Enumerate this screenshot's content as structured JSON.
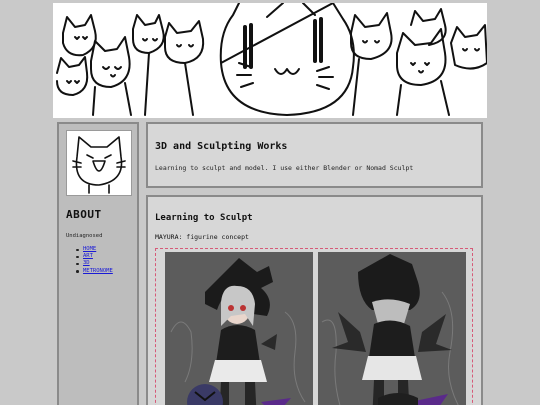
{
  "header": {
    "title": "3D and Sculpting Works",
    "subtitle": "Learning to sculpt and model. I use either Blender or Nomad Sculpt"
  },
  "sidebar": {
    "heading": "ABOUT",
    "subheading": "Undiagnosed",
    "links": [
      {
        "label": "HOME"
      },
      {
        "label": "ART"
      },
      {
        "label": "3D"
      },
      {
        "label": "METRONOME"
      }
    ]
  },
  "section": {
    "title": "Learning to Sculpt",
    "caption": "MAYURA: figurine concept"
  },
  "colors": {
    "background": "#c9c9c9",
    "panel": "#d7d7d7",
    "border": "#8a8a8a",
    "link": "#1a1ad6",
    "accent_dashed": "#d65a78"
  }
}
